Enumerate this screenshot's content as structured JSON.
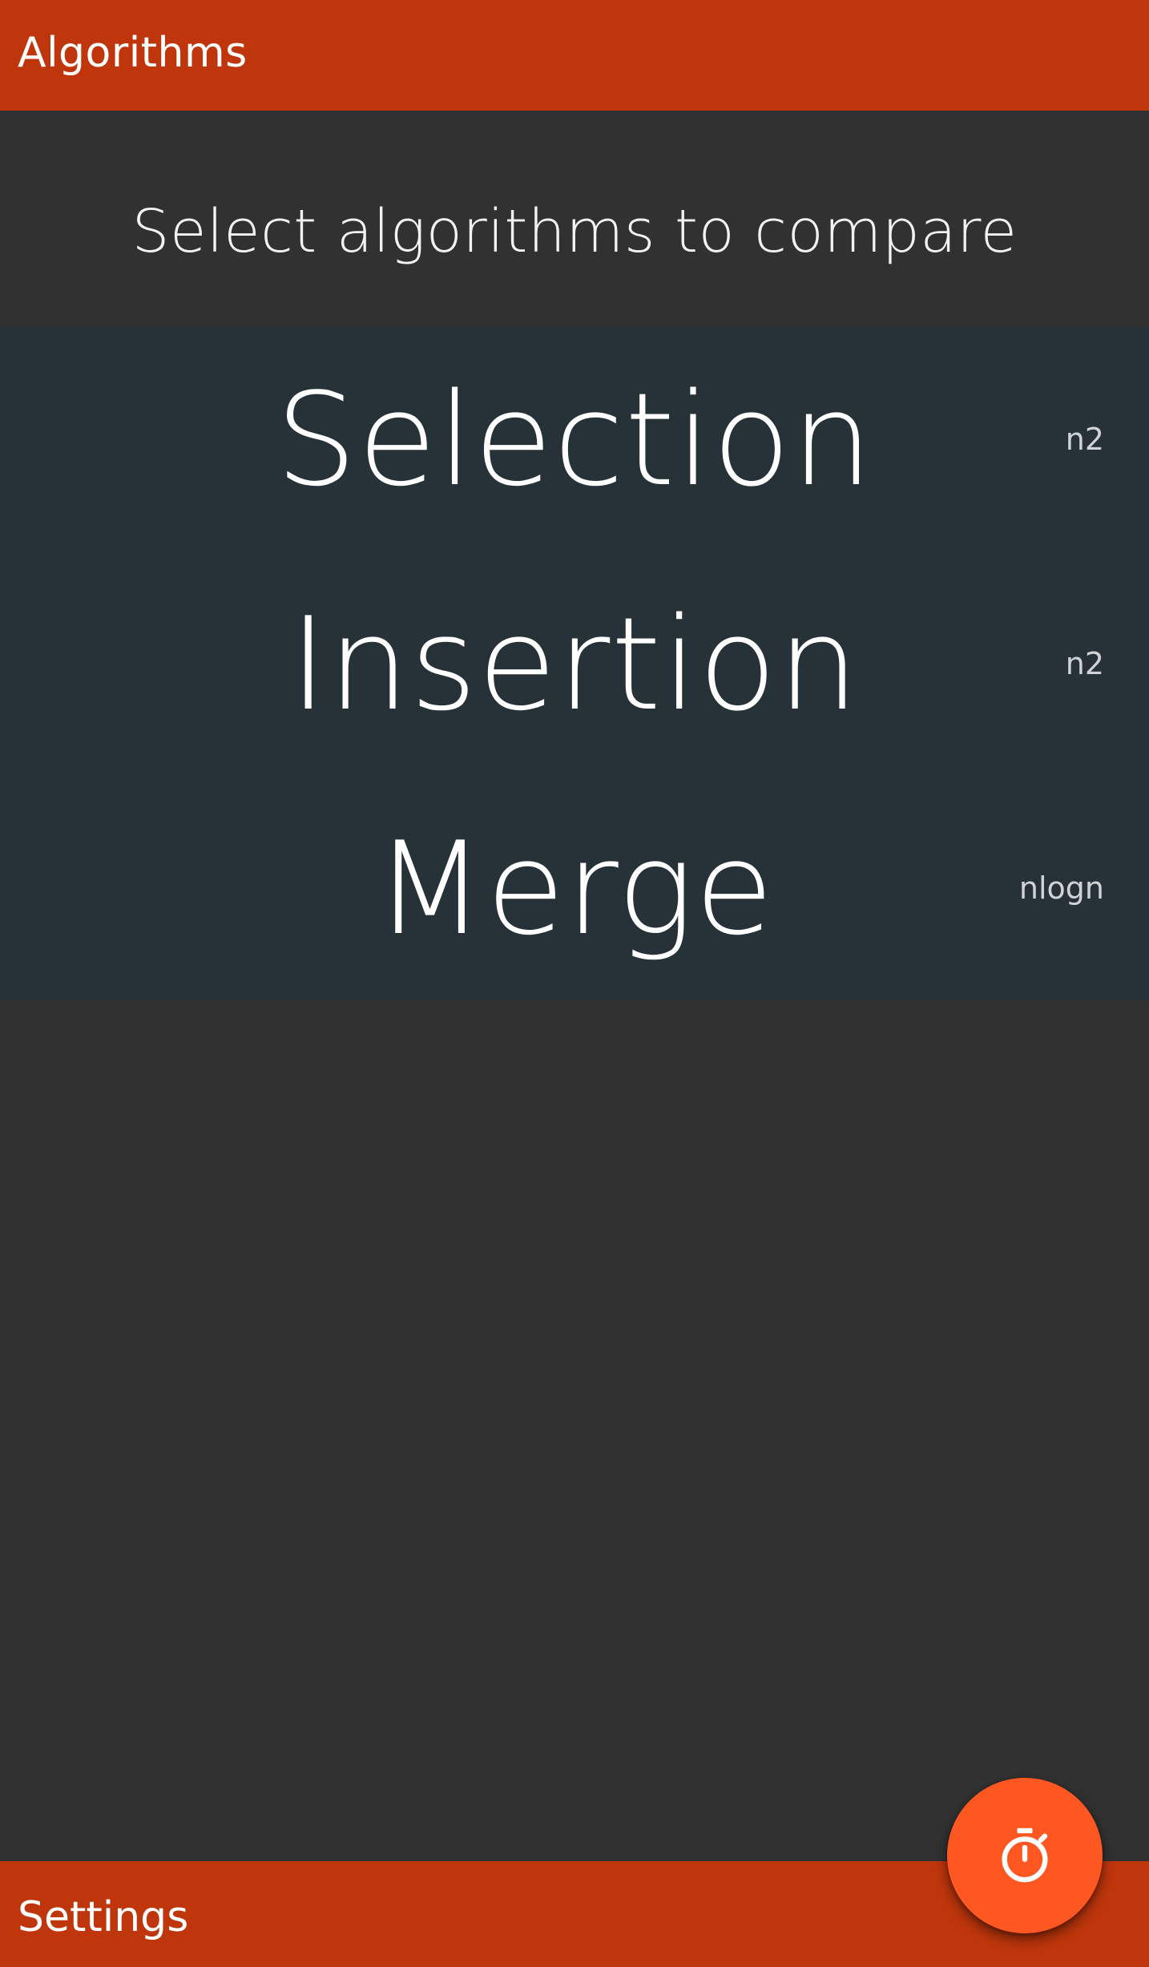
{
  "app_bar": {
    "title": "Algorithms"
  },
  "header": {
    "subtitle": "Select algorithms to compare"
  },
  "algorithms": [
    {
      "name": "Selection",
      "complexity": "n2"
    },
    {
      "name": "Insertion",
      "complexity": "n2"
    },
    {
      "name": "Merge",
      "complexity": "nlogn"
    }
  ],
  "bottom_bar": {
    "label": "Settings"
  },
  "fab": {
    "icon": "timer-icon"
  },
  "colors": {
    "primary": "#bf360c",
    "accent": "#ff5722",
    "list_background": "#263238",
    "page_background": "#313131"
  }
}
